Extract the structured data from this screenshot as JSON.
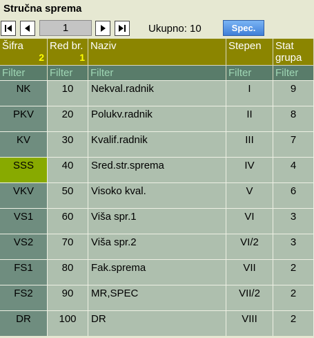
{
  "title": "Stručna sprema",
  "pager": {
    "page": "1",
    "total_label": "Ukupno: 10"
  },
  "spec_button": "Spec.",
  "columns": [
    {
      "label": "Šifra",
      "sort": "2"
    },
    {
      "label": "Red br.",
      "sort": "1"
    },
    {
      "label": "Naziv",
      "sort": ""
    },
    {
      "label": "Stepen",
      "sort": ""
    },
    {
      "label": "Stat grupa",
      "sort": ""
    }
  ],
  "filter_label": "Filter",
  "rows": [
    {
      "sifra": "NK",
      "red": "10",
      "naziv": "Nekval.radnik",
      "stepen": "I",
      "grupa": "9",
      "selected": false
    },
    {
      "sifra": "PKV",
      "red": "20",
      "naziv": "Polukv.radnik",
      "stepen": "II",
      "grupa": "8",
      "selected": false
    },
    {
      "sifra": "KV",
      "red": "30",
      "naziv": "Kvalif.radnik",
      "stepen": "III",
      "grupa": "7",
      "selected": false
    },
    {
      "sifra": "SSS",
      "red": "40",
      "naziv": "Sred.str.sprema",
      "stepen": "IV",
      "grupa": "4",
      "selected": true
    },
    {
      "sifra": "VKV",
      "red": "50",
      "naziv": "Visoko kval.",
      "stepen": "V",
      "grupa": "6",
      "selected": false
    },
    {
      "sifra": "VS1",
      "red": "60",
      "naziv": "Viša spr.1",
      "stepen": "VI",
      "grupa": "3",
      "selected": false
    },
    {
      "sifra": "VS2",
      "red": "70",
      "naziv": "Viša spr.2",
      "stepen": "VI/2",
      "grupa": "3",
      "selected": false
    },
    {
      "sifra": "FS1",
      "red": "80",
      "naziv": "Fak.sprema",
      "stepen": "VII",
      "grupa": "2",
      "selected": false
    },
    {
      "sifra": "FS2",
      "red": "90",
      "naziv": "MR,SPEC",
      "stepen": "VII/2",
      "grupa": "2",
      "selected": false
    },
    {
      "sifra": "DR",
      "red": "100",
      "naziv": "DR",
      "stepen": "VIII",
      "grupa": "2",
      "selected": false
    }
  ],
  "colors": {
    "header": "#8b8500",
    "filter": "#597c6a",
    "key_col": "#6f8d7f",
    "selected": "#88aa00",
    "cell": "#aebfae"
  },
  "icons": [
    "first-page-icon",
    "prev-page-icon",
    "next-page-icon",
    "last-page-icon"
  ]
}
